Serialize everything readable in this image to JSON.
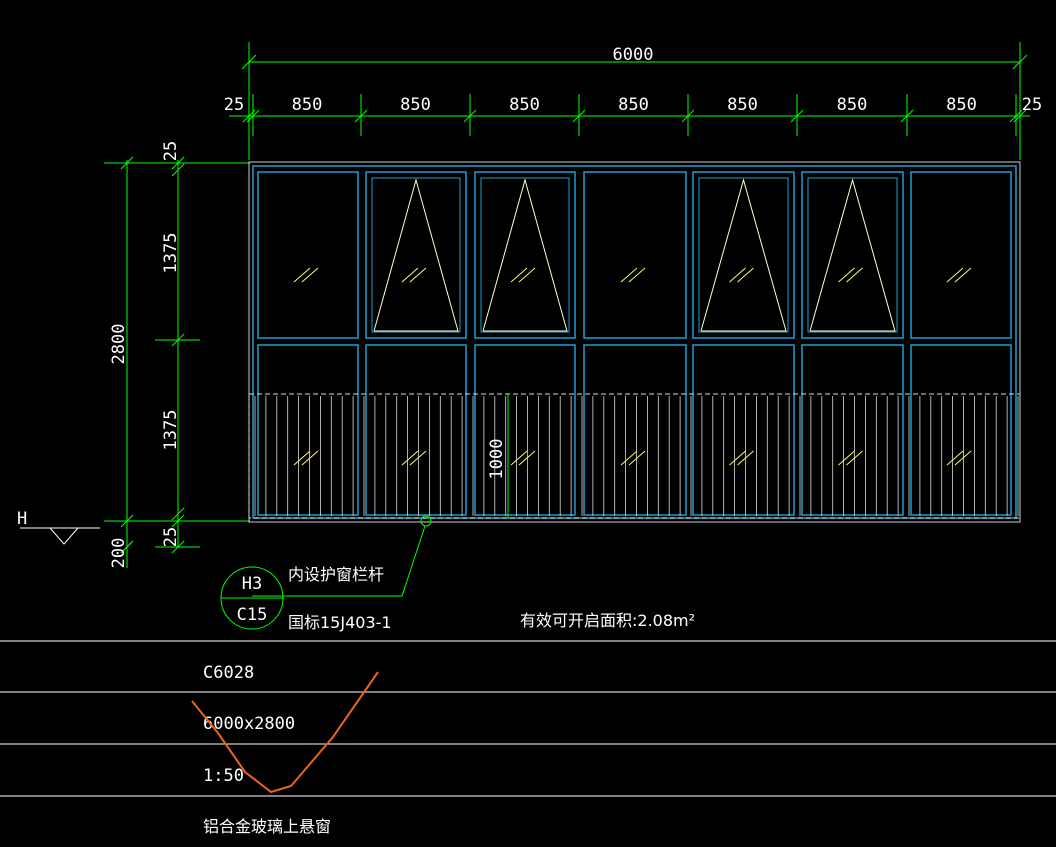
{
  "colors": {
    "background": "#000000",
    "dimension_line": "#00ff00",
    "frame": "#1f9ed0",
    "text": "#ffffff",
    "sash_triangle": "#ffffcc",
    "glass_mark": "#ffff66",
    "grille": "#dddddd",
    "markup_stroke": "#e8651a"
  },
  "dimensions": {
    "overall_width": "6000",
    "left_margin": "25",
    "right_margin": "25",
    "panel_widths": [
      "850",
      "850",
      "850",
      "850",
      "850",
      "850",
      "850"
    ],
    "overall_height": "2800",
    "top_margin": "25",
    "upper_panel": "1375",
    "lower_panel": "1375",
    "bottom_margin": "25",
    "sill_height": "200",
    "grille_height": "1000"
  },
  "panels": {
    "upper_openable": [
      false,
      true,
      true,
      false,
      true,
      true,
      false
    ]
  },
  "annotations": {
    "level_marker": "H",
    "tag_top": "H3",
    "tag_bottom": "C15",
    "note_line1": "内设护窗栏杆",
    "note_line2": "国标15J403-1",
    "effective_area": "有效可开启面积:2.08m²"
  },
  "title_block": {
    "code": "C6028",
    "size": "6000x2800",
    "scale": "1:50",
    "description": "铝合金玻璃上悬窗"
  }
}
